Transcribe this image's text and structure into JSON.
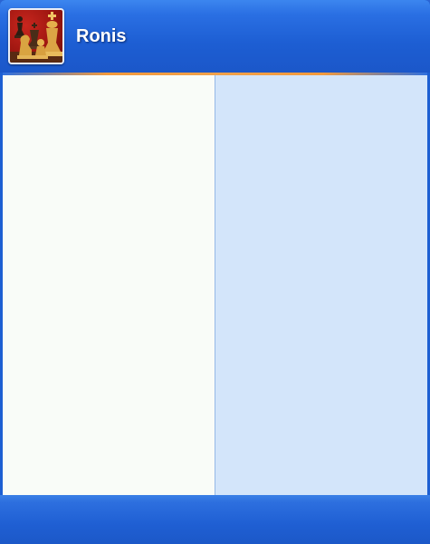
{
  "user": {
    "name": "Ronis",
    "avatar_icon": "chess-pieces-icon"
  },
  "colors": {
    "header": "#1d5ed3",
    "separator": "#f39a3c",
    "left_pane": "#f9fcf8",
    "right_pane": "#d3e5fa",
    "footer": "#1f5fd3"
  }
}
